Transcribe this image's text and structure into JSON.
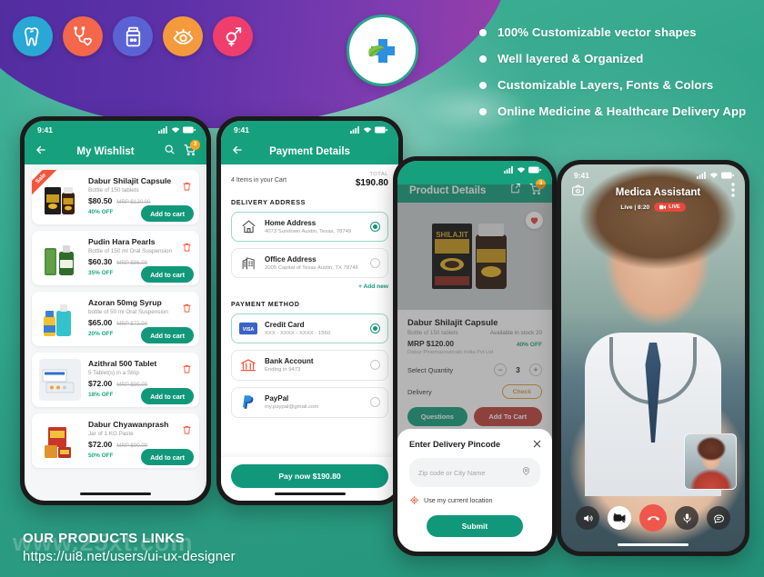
{
  "header": {
    "category_icons": [
      {
        "name": "tooth-icon",
        "color": "#29a8d6"
      },
      {
        "name": "stethoscope-heart-icon",
        "color": "#f4674a"
      },
      {
        "name": "medicine-bottle-icon",
        "color": "#5b63d4"
      },
      {
        "name": "eye-icon",
        "color": "#f59a3c"
      },
      {
        "name": "gender-symbols-icon",
        "color": "#ef3e6d"
      }
    ],
    "logo": {
      "name": "medical-cross-leaf-logo",
      "cross_color": "#2d8fe0",
      "leaf_color": "#7ec241"
    }
  },
  "features": [
    "100% Customizable vector shapes",
    "Well layered & Organized",
    "Customizable Layers, Fonts & Colors",
    "Online Medicine & Healthcare Delivery App"
  ],
  "footer": {
    "title": "OUR PRODUCTS LINKS",
    "url": "https://ui8.net/users/ui-ux-designer",
    "watermark": "www.25xt.com"
  },
  "wishlist": {
    "status_time": "9:41",
    "title": "My Wishlist",
    "cart_badge": "3",
    "items": [
      {
        "name": "Dabur Shilajit Capsule",
        "sub": "Bottle of 150 tablets",
        "price": "$80.50",
        "mrp": "MRP $120.00",
        "off": "40% OFF",
        "add": "Add to cart",
        "ribbon": "Sale"
      },
      {
        "name": "Pudin Hara Pearls",
        "sub": "Bottle of 150 ml Oral Suspension",
        "price": "$60.30",
        "mrp": "MRP $86.00",
        "off": "35% OFF",
        "add": "Add to cart",
        "ribbon": ""
      },
      {
        "name": "Azoran 50mg Syrup",
        "sub": "bottle of 50 ml Oral Suspension",
        "price": "$65.00",
        "mrp": "MRP $72.00",
        "off": "20% OFF",
        "add": "Add to cart",
        "ribbon": ""
      },
      {
        "name": "Azithral 500 Tablet",
        "sub": "5 Tablet(s) in a Strip",
        "price": "$72.00",
        "mrp": "MRP $90.00",
        "off": "18% OFF",
        "add": "Add to cart",
        "ribbon": ""
      },
      {
        "name": "Dabur Chyawanprash",
        "sub": "Jar of 1 KG Paste",
        "price": "$72.00",
        "mrp": "MRP $90.00",
        "off": "50% OFF",
        "add": "Add to cart",
        "ribbon": ""
      }
    ]
  },
  "payment": {
    "status_time": "9:41",
    "title": "Payment Details",
    "cart_items": "4 Items in your Cart",
    "total_label": "TOTAL",
    "total_value": "$190.80",
    "address_section": "DELIVERY ADDRESS",
    "addresses": [
      {
        "name": "Home Address",
        "sub": "4073  Sundown Austin, Texas, 78749",
        "selected": true,
        "icon": "home-icon"
      },
      {
        "name": "Office Address",
        "sub": "2005 Capital of Texas Austin, TX 78746",
        "selected": false,
        "icon": "office-building-icon"
      }
    ],
    "add_new": "+ Add new",
    "method_section": "PAYMENT METHOD",
    "methods": [
      {
        "name": "Credit Card",
        "sub": "XXX - XXXX - XXXX - 1560",
        "selected": true,
        "icon": "visa-card-icon"
      },
      {
        "name": "Bank Account",
        "sub": "Ending in 9473",
        "selected": false,
        "icon": "bank-icon"
      },
      {
        "name": "PayPal",
        "sub": "my.paypal@gmail.com",
        "selected": false,
        "icon": "paypal-icon"
      }
    ],
    "pay_button": "Pay now $190.80"
  },
  "product": {
    "title": "Product Details",
    "cart_badge": "3",
    "name": "Dabur Shilajit Capsule",
    "sub": "Bottle of 150 tablets",
    "stock": "Available in stock 20",
    "mrp": "MRP $120.00",
    "off": "40% OFF",
    "manufacturer": "Dabur Pharmaceuticals India Pvt Ltd",
    "qty_label": "Select Quantity",
    "qty_value": "3",
    "delivery_label": "Delivery",
    "check_button": "Check",
    "questions_button": "Questions",
    "addtocart_button": "Add To Cart",
    "pincode": {
      "title": "Enter Delivery Pincode",
      "placeholder": "Zip code or City Name",
      "current_location": "Use my current location",
      "submit": "Submit"
    }
  },
  "call": {
    "status_time": "9:41",
    "title": "Medica Assistant",
    "live_time": "Live | 8:20",
    "live_badge": "LIVE",
    "controls": [
      {
        "name": "speaker-icon",
        "style": "dark"
      },
      {
        "name": "video-off-icon",
        "style": "light"
      },
      {
        "name": "end-call-icon",
        "style": "end"
      },
      {
        "name": "microphone-icon",
        "style": "dark"
      },
      {
        "name": "chat-icon",
        "style": "dark"
      }
    ]
  }
}
